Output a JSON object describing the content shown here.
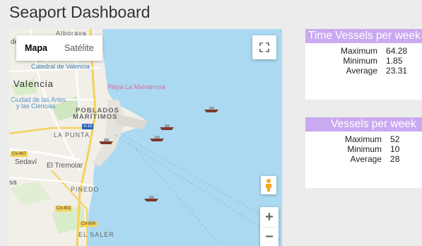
{
  "title": "Seaport Dashboard",
  "map": {
    "map_type_buttons": [
      {
        "label": "Mapa",
        "active": true
      },
      {
        "label": "Satélite",
        "active": false
      }
    ],
    "zoom_in": "+",
    "zoom_out": "−",
    "labels": {
      "alboraya": "Alboraya",
      "de": "de",
      "catedral": "Catedral de Valencia",
      "valencia": "Valencia",
      "playa": "Playa La Malvarrosa",
      "ciudad_artes_1": "Ciudad de las Artes",
      "ciudad_artes_2": "y las Ciencias",
      "poblados_1": "POBLADOS",
      "poblados_2": "MARÍTIMOS",
      "la_punta": "LA PUNTA",
      "sedavi": "Sedaví",
      "el_tremolar": "El Tremolar",
      "pinedo": "PINEDO",
      "el_saler": "EL SALER",
      "sa": "sa",
      "v15": "V-15",
      "cv407": "CV-407",
      "cv401": "CV-401",
      "cv500": "CV-500"
    },
    "colors": {
      "water": "#abd9f1",
      "land": "#f2efe9",
      "accent_road": "#f5d15a"
    }
  },
  "panels": [
    {
      "header": "Time Vessels per week",
      "rows": [
        {
          "label": "Maximum",
          "value": "64.28"
        },
        {
          "label": "Minimum",
          "value": "1.85"
        },
        {
          "label": "Average",
          "value": "23.31"
        }
      ]
    },
    {
      "header": "Vessels per week",
      "rows": [
        {
          "label": "Maximum",
          "value": "52"
        },
        {
          "label": "Minimum",
          "value": "10"
        },
        {
          "label": "Average",
          "value": "28"
        }
      ]
    }
  ],
  "colors": {
    "panel_header": "#c9a9f0",
    "background": "#ececec"
  }
}
